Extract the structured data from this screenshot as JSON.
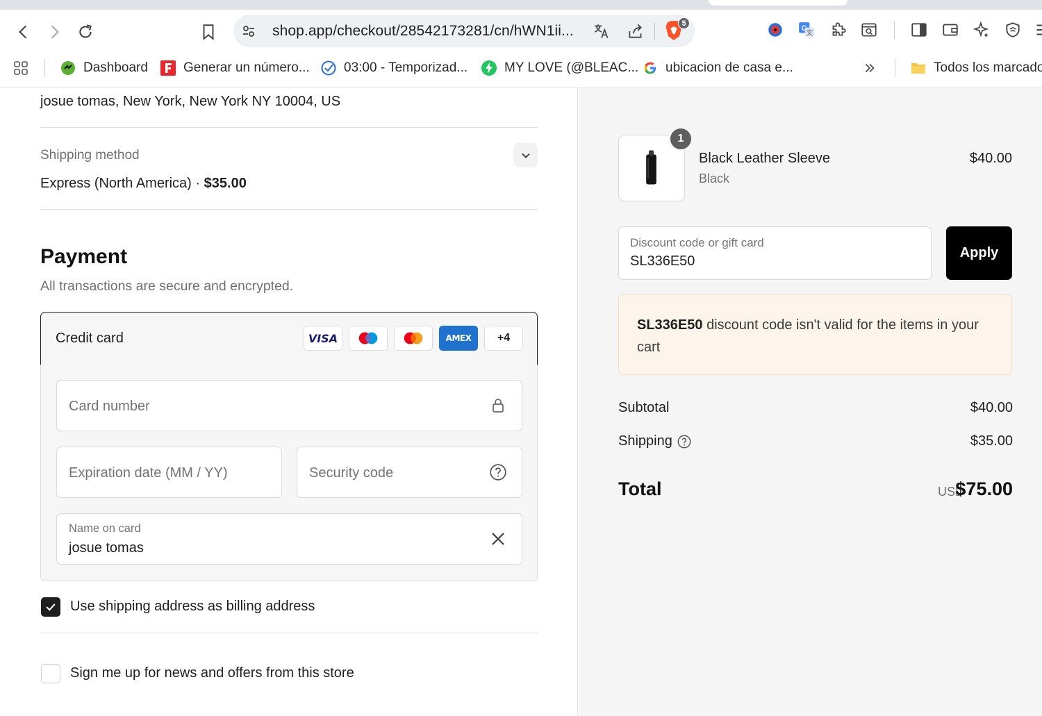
{
  "browser": {
    "url": "shop.app/checkout/28542173281/cn/hWN1ii...",
    "brave_badge": "5",
    "bookmarks": [
      {
        "label": "Dashboard",
        "icon": "dashboard-favicon"
      },
      {
        "label": "Generar un número...",
        "icon": "f-favicon"
      },
      {
        "label": "03:00 - Temporizad...",
        "icon": "timer-favicon"
      },
      {
        "label": "MY LOVE (@BLEAC...",
        "icon": "bolt-favicon"
      },
      {
        "label": "ubicacion de casa e...",
        "icon": "google-favicon"
      }
    ],
    "all_bookmarks": "Todos los marcadores"
  },
  "checkout": {
    "address": "josue tomas, New York, New York NY 10004, US",
    "shipping": {
      "label": "Shipping method",
      "method": "Express (North America)",
      "separator": "·",
      "price": "$35.00"
    },
    "payment": {
      "title": "Payment",
      "subtitle": "All transactions are secure and encrypted.",
      "credit_card_label": "Credit card",
      "cards": [
        "VISA",
        "Maestro",
        "Mastercard",
        "AMEX"
      ],
      "more_cards": "+4",
      "card_number_placeholder": "Card number",
      "expiry_placeholder": "Expiration date (MM / YY)",
      "security_placeholder": "Security code",
      "name_label": "Name on card",
      "name_value": "josue tomas"
    },
    "billing_checkbox": {
      "label": "Use shipping address as billing address",
      "checked": true
    },
    "newsletter_checkbox": {
      "label": "Sign me up for news and offers from this store",
      "checked": false
    }
  },
  "summary": {
    "item": {
      "quantity": "1",
      "name": "Black Leather Sleeve",
      "variant": "Black",
      "price": "$40.00"
    },
    "discount": {
      "label": "Discount code or gift card",
      "value": "SL336E50",
      "button": "Apply"
    },
    "error": {
      "code": "SL336E50",
      "message": "discount code isn't valid for the items in your cart"
    },
    "subtotal_label": "Subtotal",
    "subtotal": "$40.00",
    "shipping_label": "Shipping",
    "shipping": "$35.00",
    "total_label": "Total",
    "currency": "USD",
    "total": "$75.00"
  },
  "colors": {
    "accent": "#000000",
    "error_bg": "#fdf4ec",
    "error_border": "#f6dcc4",
    "sidebar_bg": "#f5f5f5"
  }
}
